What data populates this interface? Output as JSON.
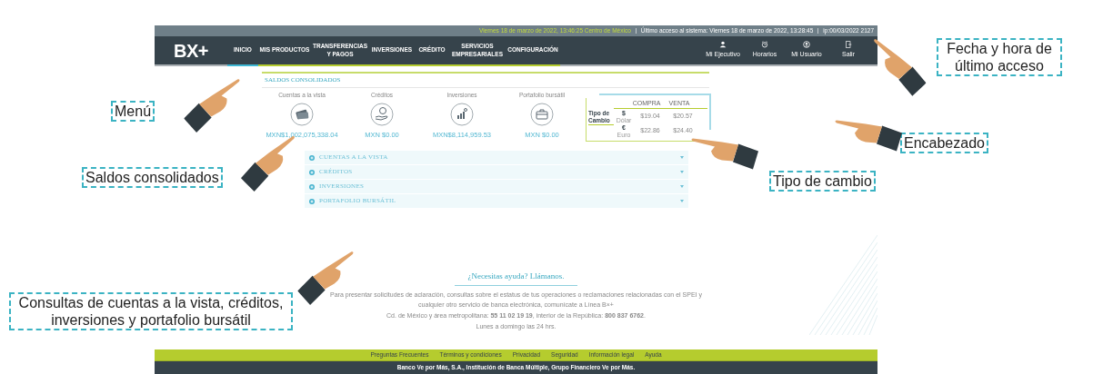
{
  "header": {
    "datetime": "Viernes 18 de marzo de 2022, 13:46:25 Centro de México",
    "last_access": "Último acceso al sistema: Viernes 18 de marzo de 2022, 13:28:45",
    "session": "ip:00/03/2022 2127"
  },
  "logo": "BX+",
  "menu": [
    {
      "label": "INICIO",
      "selected": true
    },
    {
      "label": "MIS PRODUCTOS",
      "selected": false
    },
    {
      "label": "TRANSFERENCIAS Y PAGOS",
      "selected": false
    },
    {
      "label": "INVERSIONES",
      "selected": false
    },
    {
      "label": "CRÉDITO",
      "selected": false
    },
    {
      "label": "SERVICIOS EMPRESARIALES",
      "selected": false
    },
    {
      "label": "CONFIGURACIÓN",
      "selected": false
    }
  ],
  "header_actions": [
    {
      "kind": "executive",
      "label": "Mi Ejecutivo"
    },
    {
      "kind": "clock",
      "label": "Horarios"
    },
    {
      "kind": "user",
      "label": "Mi Usuario"
    },
    {
      "kind": "exit",
      "label": "Salir"
    }
  ],
  "balances": {
    "title": "SALDOS CONSOLIDADOS",
    "items": [
      {
        "kind": "cash",
        "label": "Cuentas a la vista",
        "amount": "MXN$1,002,075,338.04"
      },
      {
        "kind": "coin-hand",
        "label": "Créditos",
        "amount": "MXN $0.00"
      },
      {
        "kind": "chart",
        "label": "Inversiones",
        "amount": "MXN$8,114,959.53"
      },
      {
        "kind": "briefcase",
        "label": "Portafolio bursátil",
        "amount": "MXN $0.00"
      }
    ]
  },
  "exchange": {
    "title_1": "Tipo de",
    "title_2": "Cambio",
    "columns": [
      "COMPRA",
      "VENTA"
    ],
    "rows": [
      {
        "symbol": "$",
        "name": "Dólar",
        "buy": "$19.04",
        "sell": "$20.57"
      },
      {
        "symbol": "€",
        "name": "Euro",
        "buy": "$22.86",
        "sell": "$24.40"
      }
    ]
  },
  "accordion": [
    {
      "label": "CUENTAS A LA VISTA",
      "expanded": false
    },
    {
      "label": "CRÉDITOS",
      "expanded": false
    },
    {
      "label": "INVERSIONES",
      "expanded": false
    },
    {
      "label": "PORTAFOLIO BURSÁTIL",
      "expanded": false
    }
  ],
  "help": {
    "title": "¿Necesitas ayuda? Llámanos.",
    "text": "Para presentar solicitudes de aclaración, consultas sobre el estatus de tus operaciones o reclamaciones relacionadas con el SPEI y cualquier otro servicio de banca electrónica, comunícate a Línea B×+",
    "phones": "Cd. de México y área metropolitana: **55 11 02 19 19**, interior de la República: **800 837 6762**.",
    "hours": "Lunes a domingo las 24 hrs."
  },
  "footer_links": [
    "Preguntas Frecuentes",
    "Términos y condiciones",
    "Privacidad",
    "Seguridad",
    "Información legal",
    "Ayuda"
  ],
  "legal": "Banco Ve por Más, S.A., Institución de Banca Múltiple, Grupo Financiero Ve por Más.",
  "annotations": [
    "Fecha y hora de último acceso",
    "Menú",
    "Encabezado",
    "Saldos consolidados",
    "Tipo de cambio",
    "Consultas de cuentas a la vista, créditos, inversiones y portafolio bursátil"
  ]
}
